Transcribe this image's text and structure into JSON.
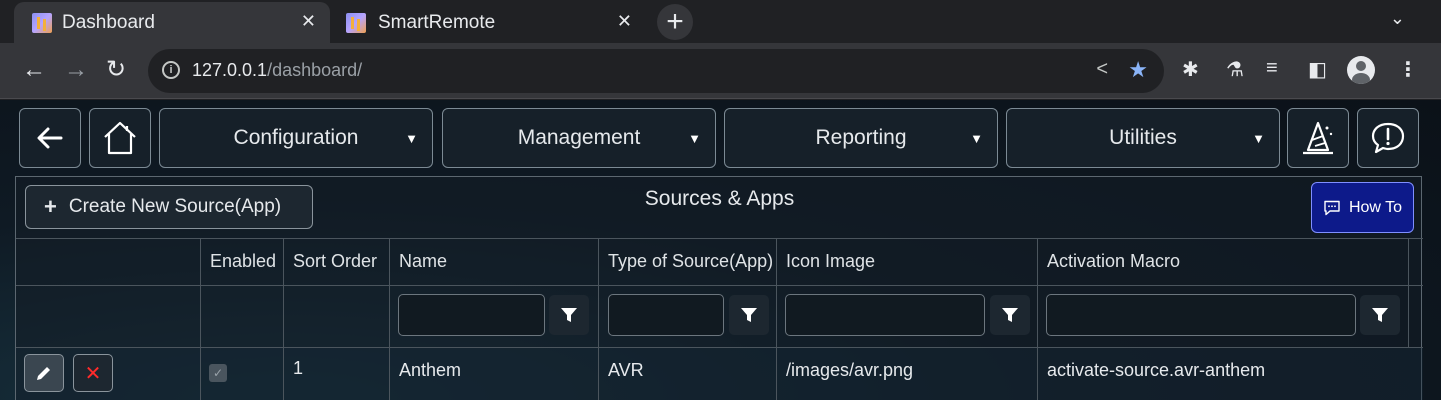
{
  "browser": {
    "tabs": [
      {
        "title": "Dashboard",
        "active": true
      },
      {
        "title": "SmartRemote",
        "active": false
      }
    ],
    "new_tab": "+",
    "url_host": "127.0.0.1",
    "url_path": "/dashboard/"
  },
  "nav": {
    "menus": [
      "Configuration",
      "Management",
      "Reporting",
      "Utilities"
    ]
  },
  "panel": {
    "create_label": "Create New Source(App)",
    "title": "Sources & Apps",
    "howto_label": "How To"
  },
  "grid": {
    "columns": [
      "",
      "Enabled",
      "Sort Order",
      "Name",
      "Type of Source(App)",
      "Icon Image",
      "Activation Macro"
    ],
    "rows": [
      {
        "enabled": true,
        "sort_order": "1",
        "name": "Anthem",
        "type": "AVR",
        "icon_image": "/images/avr.png",
        "activation_macro": "activate-source.avr-anthem"
      }
    ]
  },
  "colors": {
    "accent": "#0d1a8a",
    "delete": "#ff2b2b",
    "star": "#8ab4f8"
  }
}
